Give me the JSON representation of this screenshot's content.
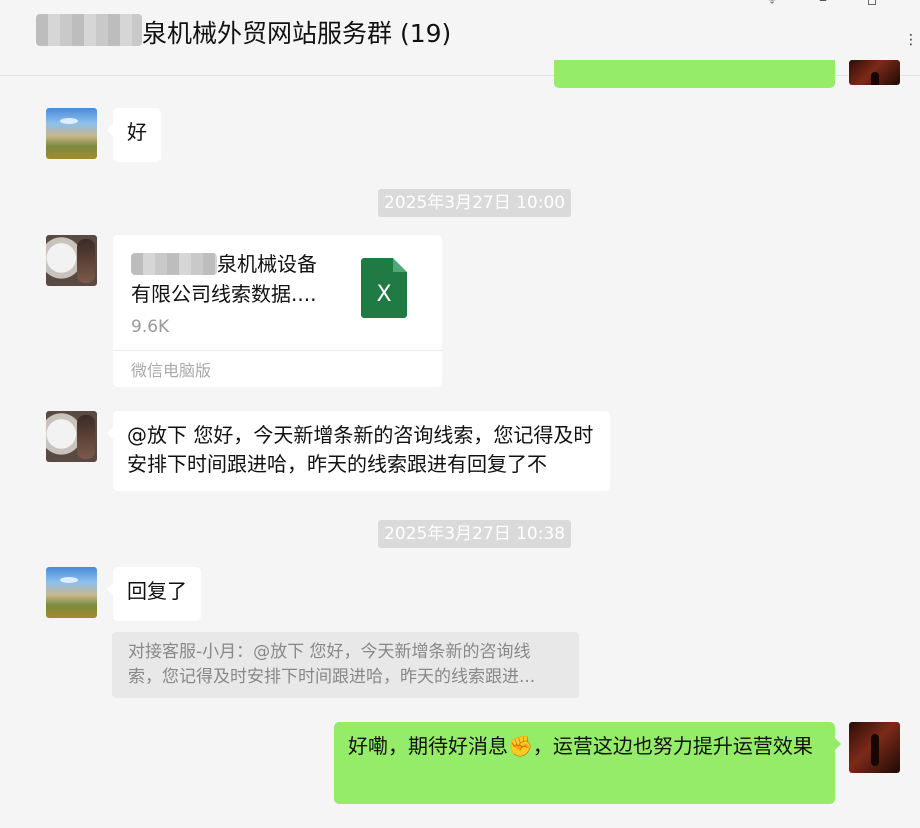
{
  "header": {
    "title": "泉机械外贸网站服务群 (19)",
    "pin_icon": "pin-icon",
    "minimize_icon": "minimize-icon",
    "maximize_icon": "maximize-icon",
    "more_icon": "more-icon"
  },
  "messages": {
    "m1": {
      "text": "好"
    },
    "t1": {
      "text": "2025年3月27日 10:00"
    },
    "file": {
      "name_line1": "泉机械设备",
      "name_line2": "有限公司线索数据....",
      "size": "9.6K",
      "source": "微信电脑版",
      "icon_letter": "X"
    },
    "m2": {
      "text": "@放下 您好，今天新增条新的咨询线索，您记得及时安排下时间跟进哈，昨天的线索跟进有回复了不"
    },
    "t2": {
      "text": "2025年3月27日 10:38"
    },
    "m3": {
      "text": "回复了"
    },
    "quote": {
      "line1": "对接客服-小月：@放下 您好，今天新增条新的咨询线",
      "line2": "索，您记得及时安排下时间跟进哈，昨天的线索跟进..."
    },
    "m4": {
      "text": "好嘞，期待好消息✊，运营这边也努力提升运营效果"
    }
  },
  "colors": {
    "background": "#f5f5f5",
    "outgoing_bubble": "#95ec69",
    "incoming_bubble": "#ffffff",
    "excel_green": "#1f7a44"
  }
}
